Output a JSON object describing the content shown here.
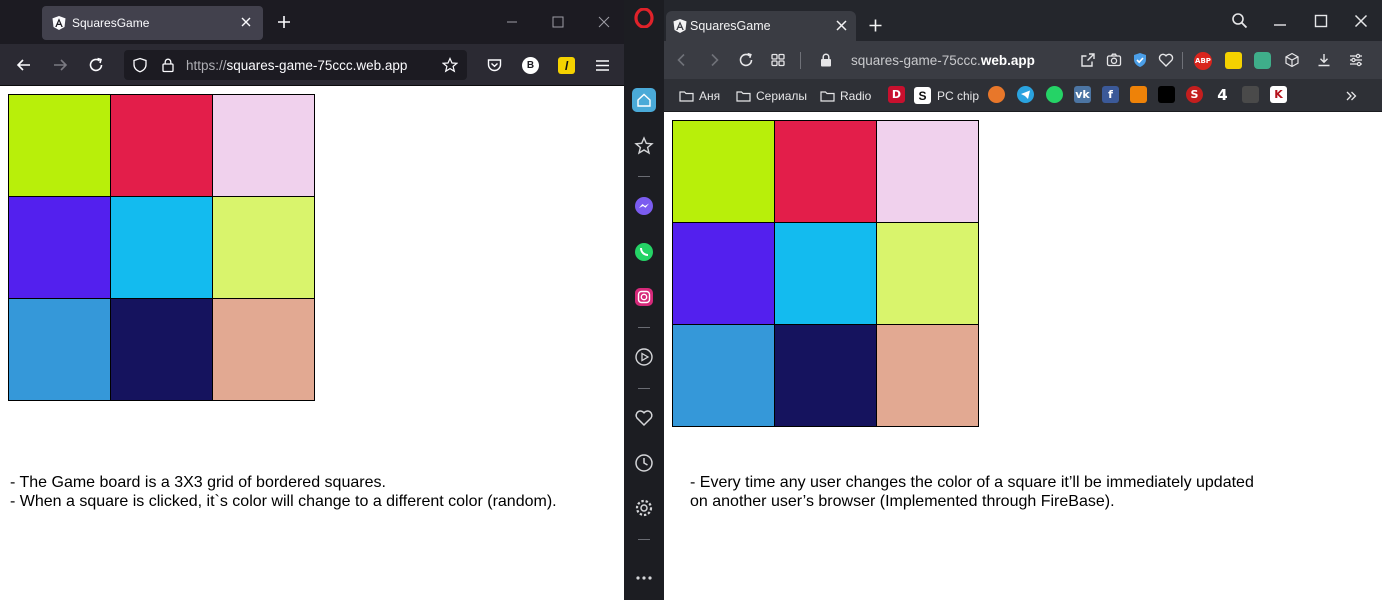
{
  "left_browser": {
    "tab_title": "SquaresGame",
    "url_protocol": "https://",
    "url_host": "squares-game-75ccc.web.app",
    "ext_b_label": "B",
    "ext_l_label": "l"
  },
  "right_browser": {
    "tab_title": "SquaresGame",
    "url_domain": "squares-game-75ccc.",
    "url_bold": "web.app",
    "abp_label": "ABP",
    "bookmarks": [
      {
        "label": "Аня"
      },
      {
        "label": "Сериалы"
      },
      {
        "label": "Radio"
      },
      {
        "label": "PC chip"
      }
    ]
  },
  "board": {
    "colors": [
      "#b8ef0a",
      "#e31e4a",
      "#f0d1ed",
      "#5320ee",
      "#13bbef",
      "#d9f46c",
      "#3598d9",
      "#15135e",
      "#e2a992"
    ]
  },
  "notes_left": {
    "line1": "- The Game board is a 3X3 grid of bordered squares.",
    "line2": "- When a square is clicked, it`s color will change to a different color (random)."
  },
  "notes_right": {
    "line1": "- Every time any user changes the color of a square it’ll be immediately updated",
    "line2": "on another user’s browser (Implemented through FireBase)."
  }
}
